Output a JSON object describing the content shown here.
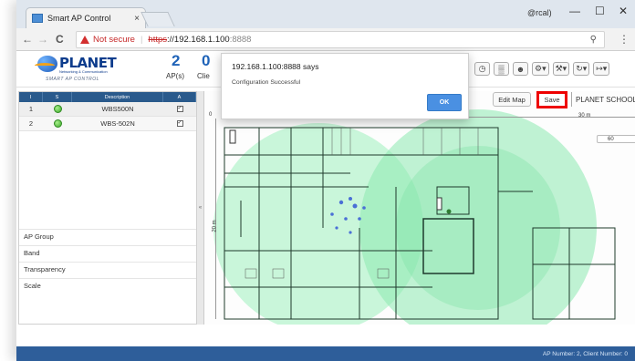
{
  "browser": {
    "tab_title": "Smart AP Control",
    "tab_close": "×",
    "user": "@rcal)",
    "window_controls": [
      "—",
      "☐",
      "✕"
    ],
    "nav": {
      "back": "←",
      "forward": "→",
      "reload": "C"
    },
    "security_label": "Not secure",
    "url_scheme": "https",
    "url_rest_host": "://192.168.1.100",
    "url_port": ":8888",
    "zoom_icon": "magnifier-icon",
    "menu": "⋮"
  },
  "header": {
    "logo_brand": "PLANET",
    "logo_sub": "Networking & Communication",
    "logo_tag": "SMART AP CONTROL",
    "ap_count": "2",
    "ap_label": "AP(s)",
    "client_count": "0",
    "client_label": "Clie",
    "toolbar_icons": [
      "dashboard-icon",
      "stats-icon",
      "users-icon",
      "settings-icon",
      "tools-icon",
      "refresh-icon",
      "logout-icon"
    ]
  },
  "ap_table": {
    "columns": [
      "I",
      "S",
      "Description",
      "A"
    ],
    "rows": [
      {
        "index": "1",
        "description": "WBS500N",
        "checked": "✓"
      },
      {
        "index": "2",
        "description": "WBS-502N",
        "checked": "✓"
      }
    ]
  },
  "left_options": [
    "AP Group",
    "Band",
    "Transparency",
    "Scale"
  ],
  "collapse_glyph": "«",
  "map": {
    "edit_label": "Edit Map",
    "save_label": "Save",
    "site_name": "PLANET SCHOOL",
    "site_arrow": "▾",
    "x_origin": "0",
    "x_tick_30": "30 m",
    "y_tick_20": "20 m",
    "zoom_value": "60"
  },
  "dialog": {
    "title": "192.168.1.100:8888 says",
    "message": "Configuration Successful",
    "ok_label": "OK"
  },
  "status": {
    "text": "AP Number: 2, Client Number: 0"
  },
  "colors": {
    "heat_green": "#7de6a4",
    "status_blue": "#2e5e9a",
    "highlight_red": "#ee0000"
  }
}
